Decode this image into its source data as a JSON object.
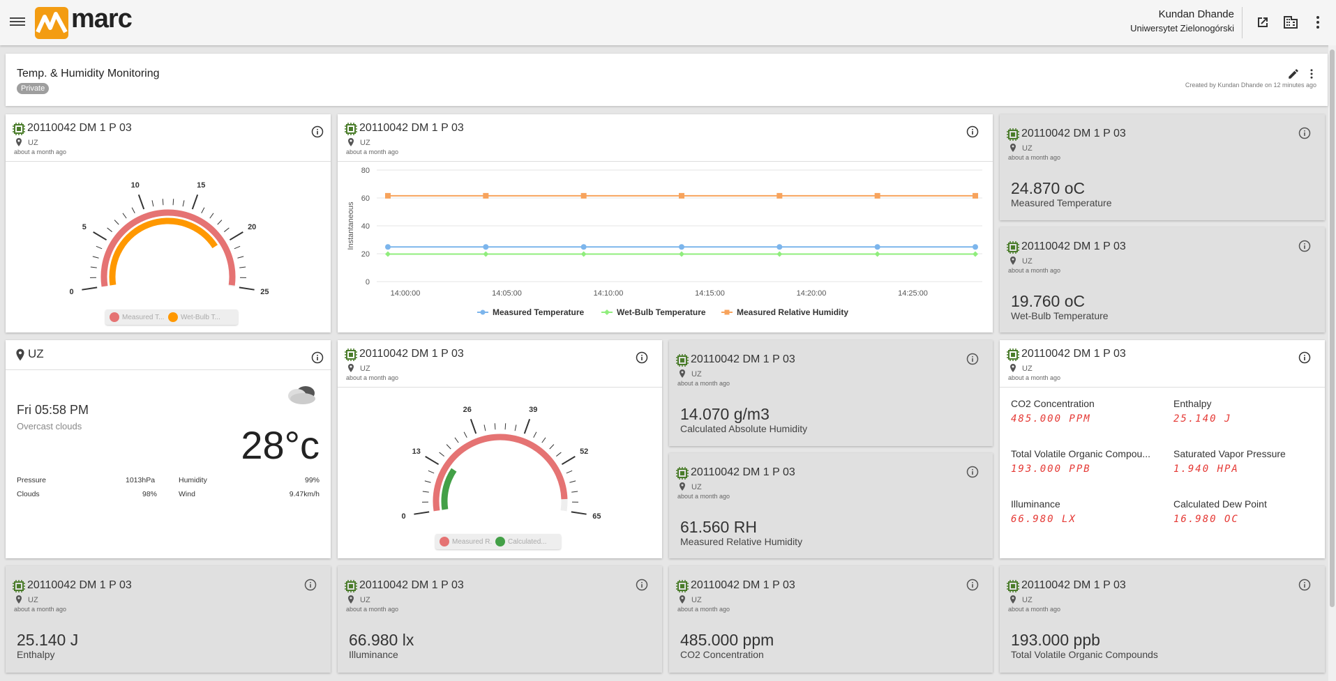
{
  "app": {
    "logo_text": "marc"
  },
  "user": {
    "name": "Kundan Dhande",
    "org": "Uniwersytet Zielonogórski"
  },
  "dashboard": {
    "title": "Temp. & Humidity Monitoring",
    "visibility": "Private",
    "created": "Created by Kundan Dhande on 12 minutes ago"
  },
  "device": {
    "name": "20110042 DM 1 P 03",
    "location": "UZ",
    "ago": "about a month ago"
  },
  "gauge1": {
    "ticks": [
      "0",
      "5",
      "10",
      "15",
      "20",
      "25"
    ],
    "legend": [
      "Measured T...",
      "Wet-Bulb T..."
    ],
    "value_outer": 24.87,
    "value_inner": 19.76,
    "max": 25,
    "colors": {
      "outer": "#e57373",
      "inner": "#ff9800"
    }
  },
  "chart_data": {
    "type": "line",
    "x": [
      "14:00:00",
      "14:05:00",
      "14:10:00",
      "14:15:00",
      "14:20:00",
      "14:25:00"
    ],
    "ylabel": "Instantaneous",
    "ylim": [
      0,
      80
    ],
    "yticks": [
      "0",
      "20",
      "40",
      "60",
      "80"
    ],
    "series": [
      {
        "name": "Measured Temperature",
        "color": "#7cb5ec",
        "marker": "circle",
        "values": [
          24.87,
          24.87,
          24.87,
          24.87,
          24.87,
          24.87,
          24.87
        ]
      },
      {
        "name": "Wet-Bulb Temperature",
        "color": "#90ed7d",
        "marker": "diamond",
        "values": [
          19.76,
          19.76,
          19.76,
          19.76,
          19.76,
          19.76,
          19.76
        ]
      },
      {
        "name": "Measured Relative Humidity",
        "color": "#f7a35c",
        "marker": "square",
        "values": [
          61.56,
          61.56,
          61.56,
          61.56,
          61.56,
          61.56,
          61.56
        ]
      }
    ],
    "grid": true,
    "legend": "bottom"
  },
  "kpi_temp": {
    "value": "24.870 oC",
    "label": "Measured Temperature"
  },
  "kpi_wetbulb": {
    "value": "19.760 oC",
    "label": "Wet-Bulb Temperature"
  },
  "weather": {
    "location": "UZ",
    "time": "Fri 05:58 PM",
    "desc": "Overcast clouds",
    "temp": "28°c",
    "icon": "cloud-icon",
    "stats": {
      "pressure_label": "Pressure",
      "pressure": "1013hPa",
      "humidity_label": "Humidity",
      "humidity": "99%",
      "clouds_label": "Clouds",
      "clouds": "98%",
      "wind_label": "Wind",
      "wind": "9.47km/h"
    }
  },
  "gauge2": {
    "ticks": [
      "0",
      "13",
      "26",
      "39",
      "52",
      "65"
    ],
    "legend": [
      "Measured R...",
      "Calculated..."
    ],
    "value_outer": 61.56,
    "value_inner": 14.07,
    "max": 65,
    "colors": {
      "outer": "#e57373",
      "inner": "#43a047"
    }
  },
  "kpi_abs_hum": {
    "value": "14.070 g/m3",
    "label": "Calculated Absolute Humidity"
  },
  "kpi_rh": {
    "value": "61.560 RH",
    "label": "Measured Relative Humidity"
  },
  "multi": {
    "items": [
      {
        "label": "CO2 Concentration",
        "value": "485.000 PPM"
      },
      {
        "label": "Enthalpy",
        "value": "25.140 J"
      },
      {
        "label": "Total Volatile Organic Compou...",
        "value": "193.000 PPB"
      },
      {
        "label": "Saturated Vapor Pressure",
        "value": "1.940 HPA"
      },
      {
        "label": "Illuminance",
        "value": "66.980 LX"
      },
      {
        "label": "Calculated Dew Point",
        "value": "16.980 OC"
      }
    ]
  },
  "kpi_enthalpy": {
    "value": "25.140 J",
    "label": "Enthalpy"
  },
  "kpi_illum": {
    "value": "66.980 lx",
    "label": "Illuminance"
  },
  "kpi_co2": {
    "value": "485.000 ppm",
    "label": "CO2 Concentration"
  },
  "kpi_tvoc": {
    "value": "193.000 ppb",
    "label": "Total Volatile Organic Compounds"
  }
}
